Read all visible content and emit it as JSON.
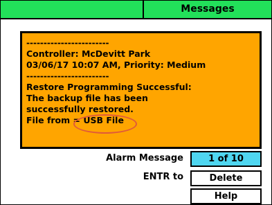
{
  "titlebar": {
    "title": "Messages",
    "accent_color": "#22e05a"
  },
  "message": {
    "background": "#ffa500",
    "lines": [
      "------------------------",
      "Controller: McDevitt Park",
      "03/06/17 10:07 AM, Priority: Medium",
      "------------------------",
      "Restore Programming Successful:",
      "The backup file has been",
      "successfully restored.",
      "File from = USB File"
    ]
  },
  "alarm": {
    "label": "Alarm Message",
    "counter": "1 of 10",
    "counter_color": "#4fd6f0"
  },
  "actions": {
    "entr_label": "ENTR to",
    "delete_label": "Delete",
    "help_label": "Help"
  }
}
